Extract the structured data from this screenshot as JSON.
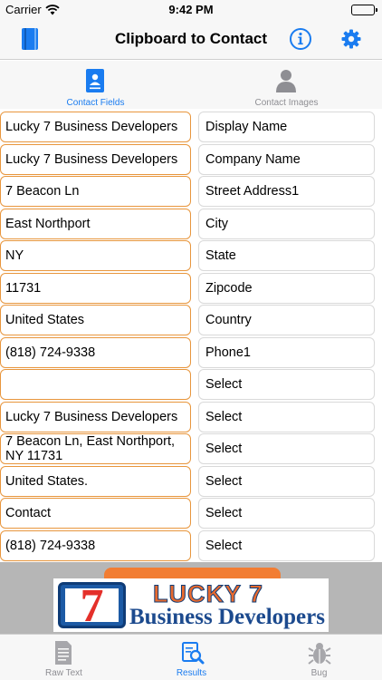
{
  "status_bar": {
    "carrier": "Carrier",
    "time": "9:42 PM"
  },
  "nav": {
    "title": "Clipboard to Contact",
    "left_icon": "book-icon",
    "info_icon": "info-icon",
    "settings_icon": "gear-icon"
  },
  "segments": [
    {
      "label": "Contact Fields",
      "icon": "contact-card-icon",
      "selected": true
    },
    {
      "label": "Contact Images",
      "icon": "person-silhouette-icon",
      "selected": false
    }
  ],
  "fields": [
    {
      "value": "Lucky 7 Business Developers",
      "key": "Display Name"
    },
    {
      "value": "Lucky 7 Business Developers",
      "key": "Company Name"
    },
    {
      "value": "7 Beacon Ln",
      "key": "Street Address1"
    },
    {
      "value": "East Northport",
      "key": "City"
    },
    {
      "value": "NY",
      "key": "State"
    },
    {
      "value": "11731",
      "key": "Zipcode"
    },
    {
      "value": "United States",
      "key": "Country"
    },
    {
      "value": "(818) 724-9338",
      "key": "Phone1"
    },
    {
      "value": "",
      "key": "Select"
    },
    {
      "value": "Lucky 7 Business Developers",
      "key": "Select"
    },
    {
      "value": "7 Beacon Ln, East Northport,\nNY 11731",
      "key": "Select"
    },
    {
      "value": "United States.",
      "key": "Select"
    },
    {
      "value": "Contact",
      "key": "Select"
    },
    {
      "value": "(818) 724-9338",
      "key": "Select"
    }
  ],
  "ad": {
    "digit": "7",
    "brand": "LUCKY 7",
    "subtitle": "Business Developers"
  },
  "tabs": [
    {
      "label": "Raw Text",
      "icon": "document-icon",
      "active": false
    },
    {
      "label": "Results",
      "icon": "results-search-icon",
      "active": true
    },
    {
      "label": "Bug",
      "icon": "bug-icon",
      "active": false
    }
  ],
  "colors": {
    "accent": "#1a7cf0",
    "field_border": "#e8963d",
    "inactive": "#8e8e93"
  }
}
